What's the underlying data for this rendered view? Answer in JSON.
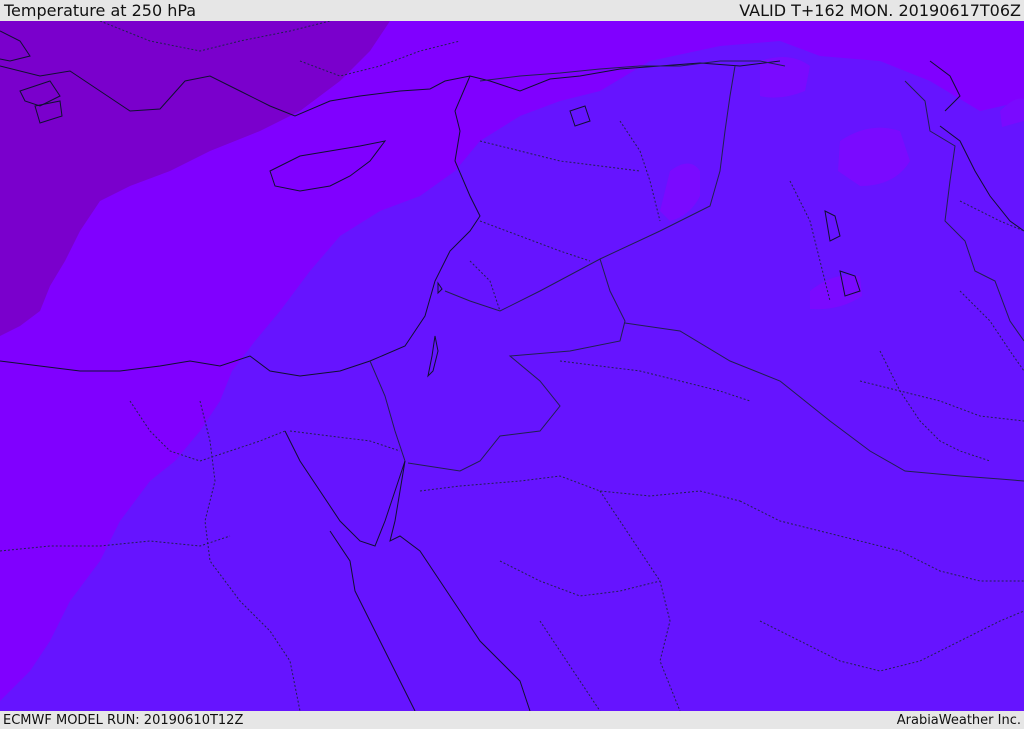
{
  "header": {
    "title": "Temperature at 250 hPa",
    "valid": "VALID T+162 MON. 20190617T06Z"
  },
  "footer": {
    "model_run": "ECMWF MODEL RUN: 20190610T12Z",
    "credit": "ArabiaWeather Inc."
  },
  "colors": {
    "coldest": "#7a00cc",
    "cold": "#8000ff",
    "mid": "#6614ff",
    "warm_patch": "#7a0aff",
    "coast": "#101030",
    "border": "#202050"
  }
}
